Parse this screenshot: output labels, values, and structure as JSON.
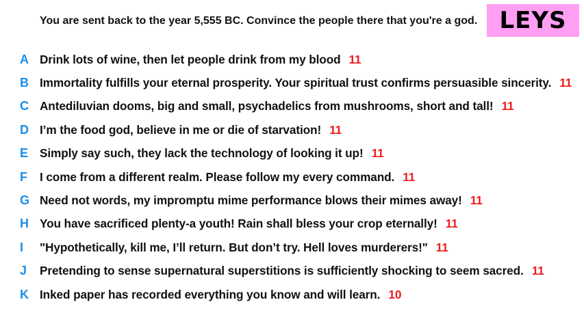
{
  "prompt": "You are sent back to the year 5,555 BC. Convince the people there that you're a god.",
  "badge": {
    "label": "LEYS",
    "color": "#ff9ff3"
  },
  "colors": {
    "letter": "#1a8ee8",
    "score": "#ee1b1b"
  },
  "answers": [
    {
      "letter": "A",
      "text": "Drink lots of wine, then let people drink from my blood",
      "score": "11"
    },
    {
      "letter": "B",
      "text": "Immortality fulfills your eternal prosperity. Your spiritual trust confirms persuasible sincerity.",
      "score": "11"
    },
    {
      "letter": "C",
      "text": "Antediluvian dooms, big and small, psychadelics from mushrooms, short and tall!",
      "score": "11"
    },
    {
      "letter": "D",
      "text": "I’m the food god, believe in me or die of starvation!",
      "score": "11"
    },
    {
      "letter": "E",
      "text": "Simply say such, they lack the technology of looking it up!",
      "score": "11"
    },
    {
      "letter": "F",
      "text": "I come from a different realm. Please follow my every command.",
      "score": "11"
    },
    {
      "letter": "G",
      "text": "Need not words, my impromptu mime performance blows their mimes away!",
      "score": "11"
    },
    {
      "letter": "H",
      "text": "You have sacrificed plenty-a youth! Rain shall bless your crop eternally!",
      "score": "11"
    },
    {
      "letter": "I",
      "text": "\"Hypothetically, kill me, I’ll return. But don’t try. Hell loves murderers!\"",
      "score": "11"
    },
    {
      "letter": "J",
      "text": "Pretending to sense supernatural superstitions is sufficiently shocking to seem sacred.",
      "score": "11"
    },
    {
      "letter": "K",
      "text": "Inked paper has recorded everything you know and will learn.",
      "score": "10"
    }
  ]
}
